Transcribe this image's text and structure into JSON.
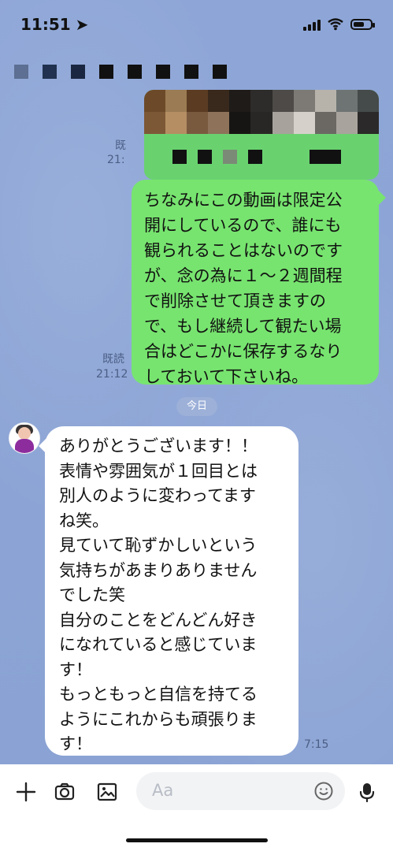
{
  "status_bar": {
    "time": "11:51"
  },
  "messages": {
    "left_meta_1": "既",
    "left_time_1": "21:",
    "out_read_label": "既読",
    "out_time": "21:12",
    "out_text": "ちなみにこの動画は限定公\n開にしているので、誰にも\n観られることはないのです\nが、念の為に１〜２週間程\nで削除させて頂きますの\nで、もし継続して観たい場\n合はどこかに保存するなり\nしておいて下さいね。",
    "day_label": "今日",
    "in_text": "ありがとうございます！！\n表情や雰囲気が１回目とは\n別人のように変わってます\nね笑。\n見ていて恥ずかしいという\n気持ちがあまりありません\nでした笑\n自分のことをどんどん好き\nになれていると感じていま\nす！\nもっともっと自信を持てる\nようにこれからも頑張りま\nす！",
    "in_time": "7:15"
  },
  "composer": {
    "placeholder": "Aa",
    "icons": [
      "add-icon",
      "camera-icon",
      "image-icon",
      "emoji-icon",
      "microphone-icon"
    ]
  },
  "colors": {
    "background": "#8EA6D7",
    "outgoing_bubble": "#77E46F",
    "incoming_bubble": "#FFFFFF",
    "meta_text": "#4C5E85"
  }
}
